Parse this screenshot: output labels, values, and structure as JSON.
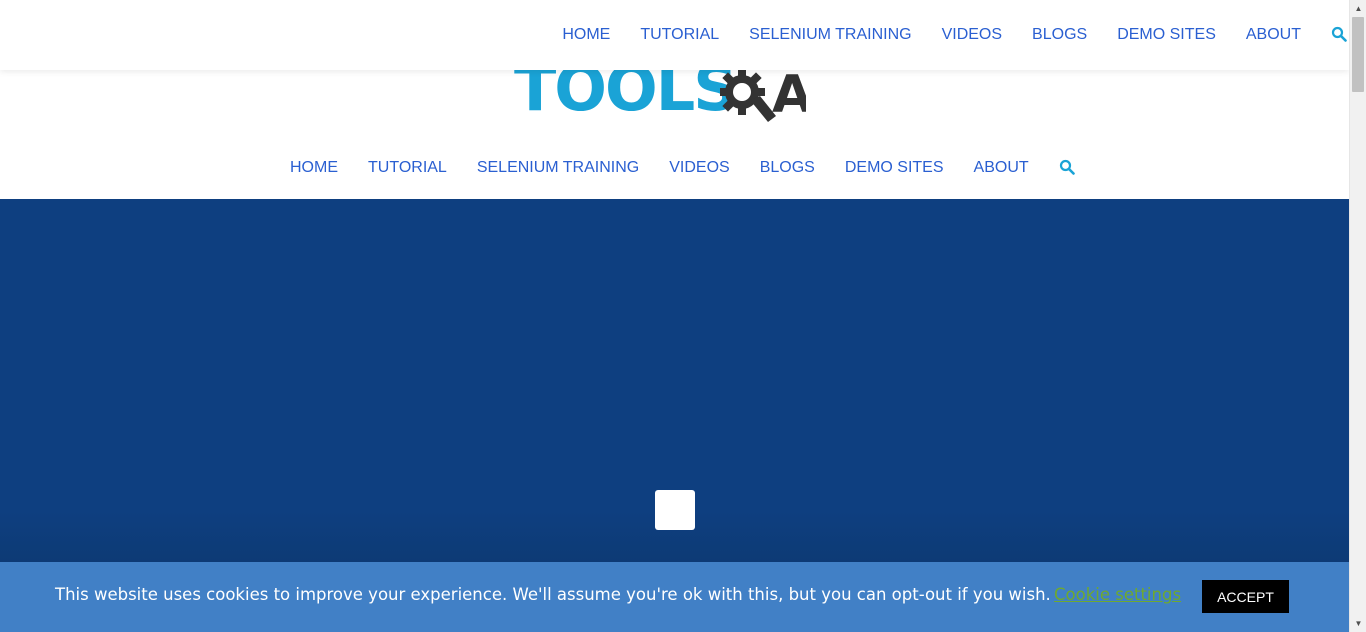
{
  "logo": {
    "text": "TOOLS",
    "suffix": "A"
  },
  "nav_items": [
    "HOME",
    "TUTORIAL",
    "SELENIUM TRAINING",
    "VIDEOS",
    "BLOGS",
    "DEMO SITES",
    "ABOUT"
  ],
  "cookie": {
    "message": "This website uses cookies to improve your experience. We'll assume you're ok with this, but you can opt-out if you wish.",
    "settings_label": "Cookie settings",
    "accept_label": "ACCEPT"
  },
  "colors": {
    "nav_link": "#2a5fd1",
    "search_icon": "#1aa3d6",
    "hero_bg": "#0e3f80",
    "cookie_bar_bg": "#4180c6",
    "cookie_settings": "#6fa92e",
    "accept_bg": "#000000"
  },
  "icons": {
    "search": "search-icon",
    "gear": "gear-icon"
  }
}
